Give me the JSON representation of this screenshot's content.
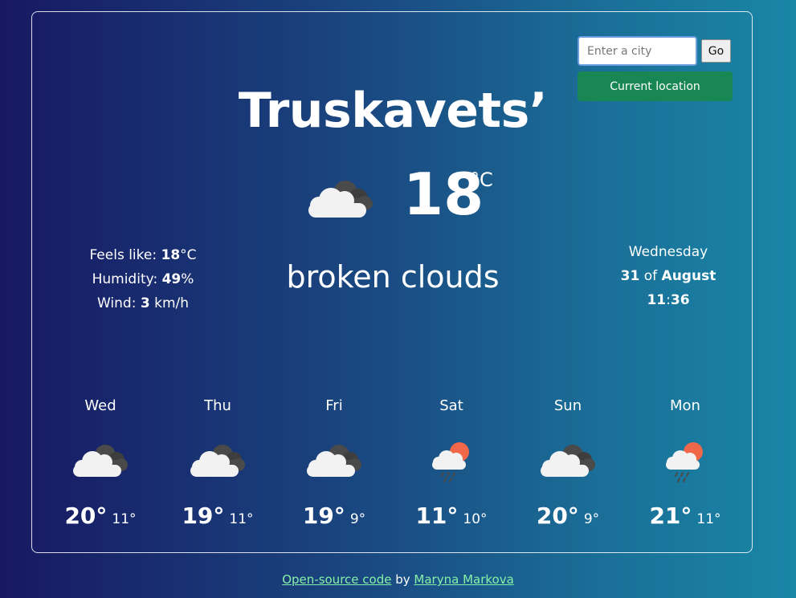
{
  "search": {
    "placeholder": "Enter a city",
    "go_label": "Go",
    "location_label": "Current location"
  },
  "current": {
    "city": "Truskavets’",
    "temperature": "18",
    "unit": "°C",
    "description": "broken clouds",
    "icon": "broken-clouds-icon",
    "feels_label": "Feels like:",
    "feels_value": "18",
    "feels_unit": "°C",
    "humidity_label": "Humidity:",
    "humidity_value": "49",
    "humidity_unit": "%",
    "wind_label": "Wind:",
    "wind_value": "3",
    "wind_unit": "km/h"
  },
  "date": {
    "weekday": "Wednesday",
    "day": "31",
    "of": "of",
    "month": "August",
    "hours": "11",
    "separator": ":",
    "minutes": "36"
  },
  "forecast": [
    {
      "day": "Wed",
      "max": "20°",
      "min": "11°",
      "icon": "broken-clouds-icon"
    },
    {
      "day": "Thu",
      "max": "19°",
      "min": "11°",
      "icon": "broken-clouds-icon"
    },
    {
      "day": "Fri",
      "max": "19°",
      "min": "9°",
      "icon": "broken-clouds-icon"
    },
    {
      "day": "Sat",
      "max": "11°",
      "min": "10°",
      "icon": "rain-sun-icon"
    },
    {
      "day": "Sun",
      "max": "20°",
      "min": "9°",
      "icon": "broken-clouds-icon"
    },
    {
      "day": "Mon",
      "max": "21°",
      "min": "11°",
      "icon": "rain-sun-icon"
    }
  ],
  "footer": {
    "code_link": "Open-source code",
    "by": "by",
    "author_link": "Maryna Markova"
  },
  "colors": {
    "accent_green": "#198754",
    "link_green": "#86f0a8",
    "sun": "#f0674a"
  }
}
